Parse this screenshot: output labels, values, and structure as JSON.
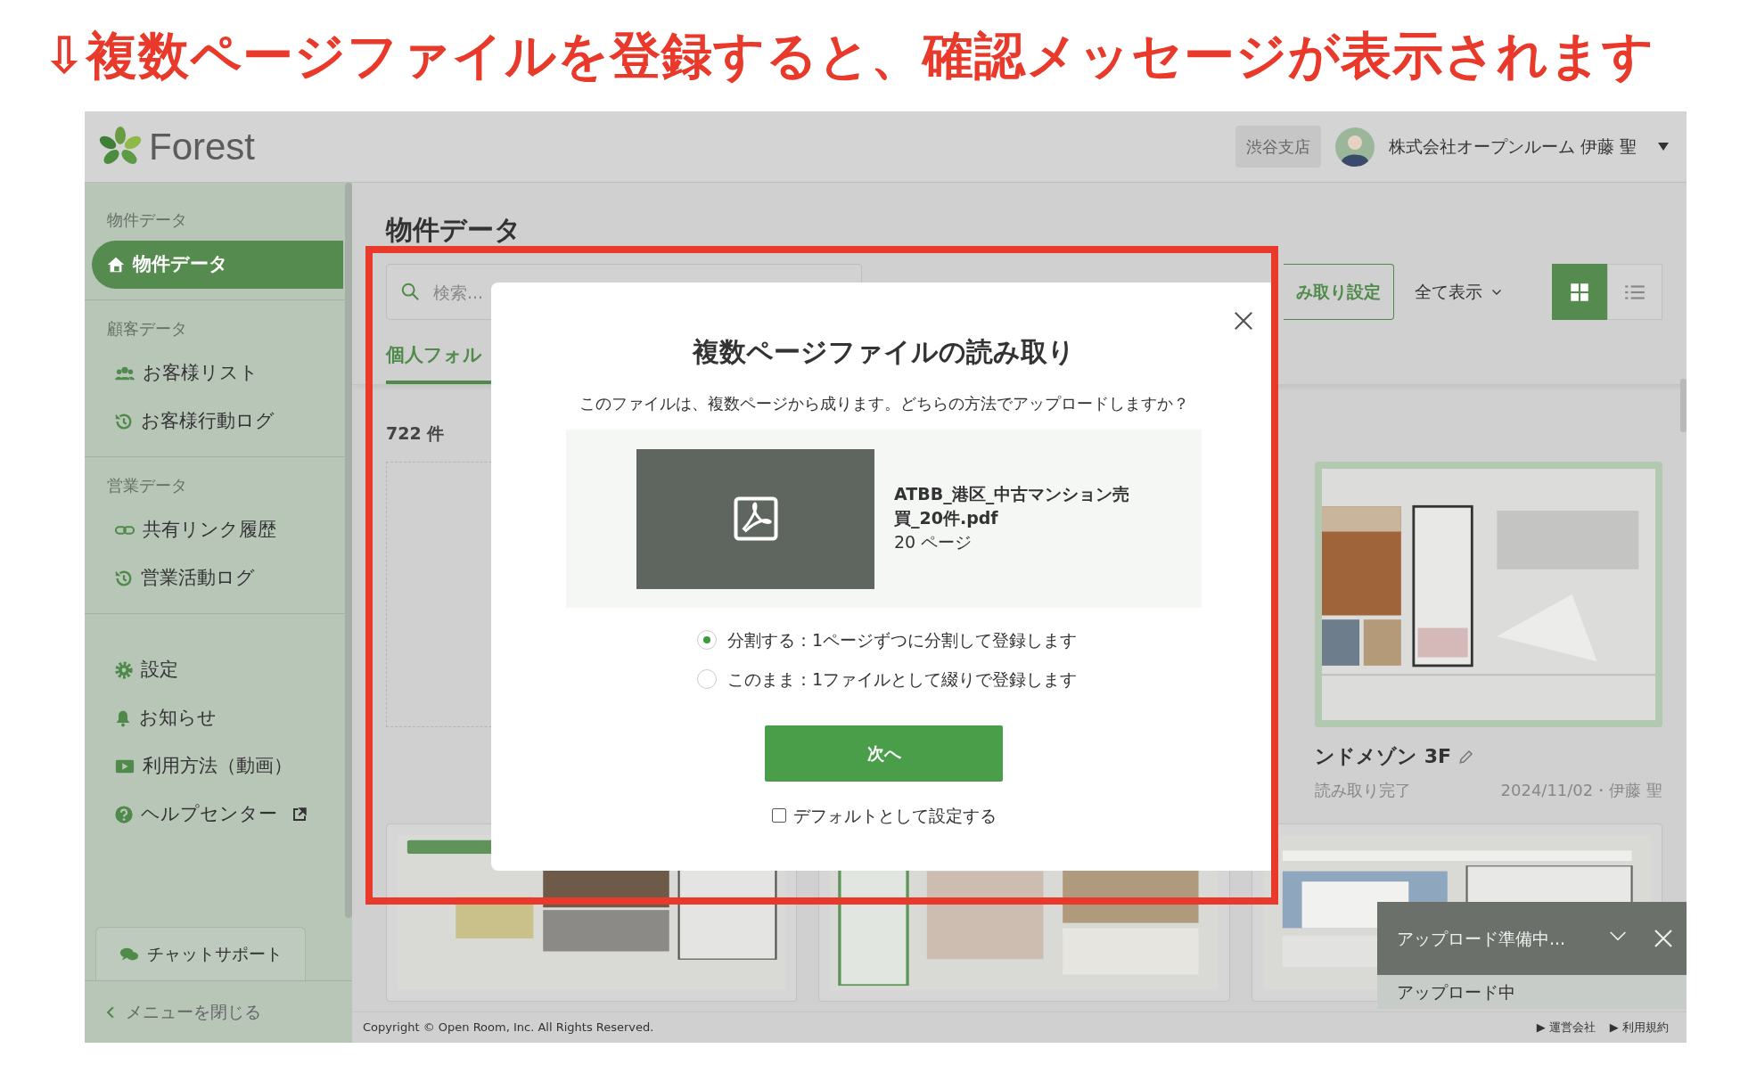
{
  "annotation": {
    "title": "⇩複数ページファイルを登録すると、確認メッセージが表示されます"
  },
  "header": {
    "logo": "Forest",
    "branch": "渋谷支店",
    "user": "株式会社オープンルーム 伊藤 聖"
  },
  "sidebar": {
    "sections": [
      {
        "label": "物件データ",
        "items": [
          {
            "label": "物件データ",
            "selected": true
          }
        ]
      },
      {
        "label": "顧客データ",
        "items": [
          {
            "label": "お客様リスト",
            "selected": false
          },
          {
            "label": "お客様行動ログ",
            "selected": false
          }
        ]
      },
      {
        "label": "営業データ",
        "items": [
          {
            "label": "共有リンク履歴",
            "selected": false
          },
          {
            "label": "営業活動ログ",
            "selected": false
          }
        ]
      }
    ],
    "footer_items": [
      {
        "label": "設定",
        "external": false
      },
      {
        "label": "お知らせ",
        "external": false
      },
      {
        "label": "利用方法（動画）",
        "external": false
      },
      {
        "label": "ヘルプセンター",
        "external": true
      }
    ],
    "chat_button": "チャットサポート",
    "close_menu": "メニューを閉じる"
  },
  "main": {
    "title": "物件データ",
    "search": {
      "placeholder": "検索..."
    },
    "settings_button": "み取り設定",
    "filter": "全て表示",
    "view_modes": [
      {
        "selected": true
      },
      {
        "selected": false
      }
    ],
    "tabs": [
      {
        "label": "個人フォル",
        "selected": true
      }
    ],
    "count": "722 件",
    "cards": [
      {
        "kind": "empty"
      },
      {
        "kind": "picture",
        "title": "ンドメゾン 3F",
        "status": "読み取り完了",
        "meta": "2024/11/02・伊藤 聖"
      }
    ]
  },
  "toast": {
    "title": "アップロード準備中...",
    "status": "アップロード中"
  },
  "footer": {
    "copyright": "Copyright © Open Room, Inc. All Rights Reserved.",
    "links": [
      "▶ 運営会社",
      "▶ 利用規約"
    ]
  },
  "modal": {
    "title": "複数ページファイルの読み取り",
    "description": "このファイルは、複数ページから成ります。どちらの方法でアップロードしますか？",
    "file": {
      "name": "ATBB_港区_中古マンション売買_20件.pdf",
      "pages": "20 ページ"
    },
    "options": [
      {
        "label": "分割する：1ページずつに分割して登録します",
        "selected": true
      },
      {
        "label": "このまま：1ファイルとして綴りで登録します",
        "selected": false
      }
    ],
    "next_button": "次へ",
    "default_checkbox": {
      "label": "デフォルトとして設定する",
      "checked": false
    }
  }
}
